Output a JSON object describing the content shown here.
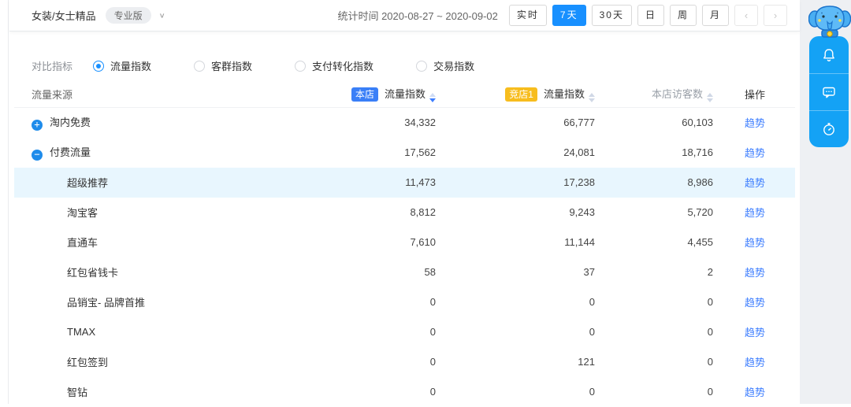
{
  "topbar": {
    "shop_category": "女装/女士精品",
    "version_badge": "专业版",
    "chevron": "∨",
    "stat_time": "统计时间 2020-08-27 ~ 2020-09-02",
    "time_buttons": [
      {
        "label": "实时",
        "active": false,
        "type": "normal"
      },
      {
        "label": "7天",
        "active": true,
        "type": "normal"
      },
      {
        "label": "30天",
        "active": false,
        "type": "normal"
      },
      {
        "label": "日",
        "active": false,
        "type": "normal"
      },
      {
        "label": "周",
        "active": false,
        "type": "normal"
      },
      {
        "label": "月",
        "active": false,
        "type": "normal"
      },
      {
        "label": "‹",
        "active": false,
        "type": "nav"
      },
      {
        "label": "›",
        "active": false,
        "type": "nav"
      }
    ]
  },
  "filters": {
    "label": "对比指标",
    "options": [
      {
        "label": "流量指数",
        "selected": true
      },
      {
        "label": "客群指数",
        "selected": false
      },
      {
        "label": "支付转化指数",
        "selected": false
      },
      {
        "label": "交易指数",
        "selected": false
      }
    ]
  },
  "table": {
    "columns": {
      "source": "流量来源",
      "own_badge": "本店",
      "own_metric": "流量指数",
      "own_sort": "desc",
      "comp_badge": "竞店1",
      "comp_metric": "流量指数",
      "comp_sort": "none",
      "visitors": "本店访客数",
      "visitors_sort": "none",
      "action": "操作"
    },
    "trend_label": "趋势",
    "rows": [
      {
        "label": "淘内免费",
        "level": "parent",
        "toggle": "+",
        "own": "34,332",
        "comp": "66,777",
        "visitors": "60,103",
        "highlight": false
      },
      {
        "label": "付费流量",
        "level": "parent",
        "toggle": "−",
        "own": "17,562",
        "comp": "24,081",
        "visitors": "18,716",
        "highlight": false
      },
      {
        "label": "超级推荐",
        "level": "child",
        "toggle": null,
        "own": "11,473",
        "comp": "17,238",
        "visitors": "8,986",
        "highlight": true
      },
      {
        "label": "淘宝客",
        "level": "child",
        "toggle": null,
        "own": "8,812",
        "comp": "9,243",
        "visitors": "5,720",
        "highlight": false
      },
      {
        "label": "直通车",
        "level": "child",
        "toggle": null,
        "own": "7,610",
        "comp": "11,144",
        "visitors": "4,455",
        "highlight": false
      },
      {
        "label": "红包省钱卡",
        "level": "child",
        "toggle": null,
        "own": "58",
        "comp": "37",
        "visitors": "2",
        "highlight": false
      },
      {
        "label": "品销宝- 品牌首推",
        "level": "child",
        "toggle": null,
        "own": "0",
        "comp": "0",
        "visitors": "0",
        "highlight": false
      },
      {
        "label": "TMAX",
        "level": "child",
        "toggle": null,
        "own": "0",
        "comp": "0",
        "visitors": "0",
        "highlight": false
      },
      {
        "label": "红包签到",
        "level": "child",
        "toggle": null,
        "own": "0",
        "comp": "121",
        "visitors": "0",
        "highlight": false
      },
      {
        "label": "智钻",
        "level": "child",
        "toggle": null,
        "own": "0",
        "comp": "0",
        "visitors": "0",
        "highlight": false
      }
    ]
  },
  "side_widgets": {
    "mascot": "elephant-mascot",
    "buttons": [
      "bell",
      "message",
      "timer"
    ]
  },
  "colors": {
    "primary_blue": "#1890ff",
    "own_badge_blue": "#3a7ff7",
    "comp_badge_yellow": "#f7bd1e",
    "highlight_row": "#e8f6fe",
    "link_blue": "#3d7eff",
    "side_widget_blue": "#14a2f5"
  }
}
